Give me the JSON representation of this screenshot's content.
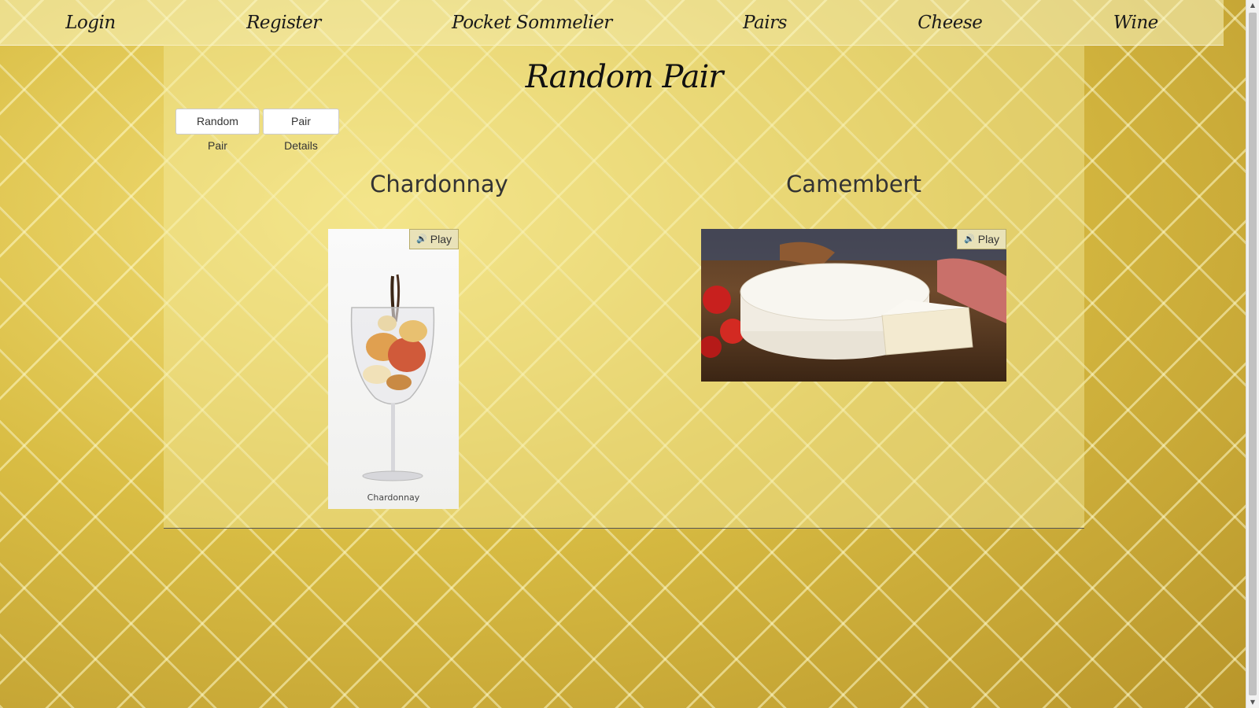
{
  "nav": {
    "items": [
      {
        "label": "Login"
      },
      {
        "label": "Register"
      },
      {
        "label": "Pocket Sommelier"
      },
      {
        "label": "Pairs"
      },
      {
        "label": "Cheese"
      },
      {
        "label": "Wine"
      }
    ]
  },
  "main": {
    "title": "Random Pair",
    "buttons": {
      "random_pair": "Random Pair",
      "pair_details": "Pair Details"
    },
    "wine": {
      "name": "Chardonnay",
      "image_caption": "Chardonnay",
      "play_label": "Play"
    },
    "cheese": {
      "name": "Camembert",
      "play_label": "Play"
    }
  },
  "icons": {
    "speaker": "speaker-icon",
    "scroll_up": "scroll-up-arrow-icon",
    "scroll_down": "scroll-down-arrow-icon"
  },
  "colors": {
    "background_gold": "#cfb238",
    "panel": "#f5eba0",
    "play_button": "#e9e2b8"
  }
}
